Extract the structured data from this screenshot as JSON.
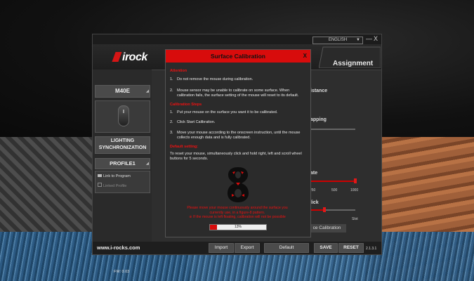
{
  "window": {
    "language": "ENGLISH",
    "minimize": "—",
    "close": "X",
    "brand": "irock",
    "tab_assignment": "Assignment"
  },
  "sidebar": {
    "model": "M40E",
    "lighting_sync_line1": "LIGHTING",
    "lighting_sync_line2": "SYNCHRONIZATION",
    "profile": "PROFILE1",
    "link_to_program": "Link to Program",
    "linked_profile": "Linked Profile",
    "firmware": "FW: 0.03"
  },
  "main_background": {
    "lift_off_distance": "istance",
    "mapping": "apping",
    "rate": "ate",
    "rate_ticks": [
      "250",
      "500",
      "1000"
    ],
    "click": "lick",
    "click_tick": "Slot",
    "surface_calibration_button": "ce Calibration"
  },
  "bottom": {
    "url": "www.i-rocks.com",
    "import": "Import",
    "export": "Export",
    "default": "Default",
    "save": "SAVE",
    "reset": "RESET",
    "version": "2.1.3.1"
  },
  "dialog": {
    "title": "Surface Calibration",
    "close": "X",
    "attention_header": "Attention",
    "attention": [
      {
        "num": "1.",
        "text": "Do not remove the mouse during calibration."
      },
      {
        "num": "2.",
        "text": "Mouse sensor may be unable to calibrate on some surface. When calibration fails, the surface setting of the mouse will reset to its default."
      }
    ],
    "steps_header": "Calibration Steps",
    "steps": [
      {
        "num": "1.",
        "text": "Put your mouse on the surface you want it to be calibrated."
      },
      {
        "num": "2.",
        "text": "Click Start Calibration."
      },
      {
        "num": "3.",
        "text": "Move your mouse according to the onscreen instruction, until the mouse collects enough data and is fully calibrated."
      }
    ],
    "default_header": "Default setting:",
    "default_text": "To reset your mouse, simultaneously click and hold right, left and scroll wheel buttons for 5 seconds.",
    "warning_line1": "Please move your mouse continuously around the surface you",
    "warning_line2": "currently use, in a figure-8 pattern.",
    "warning_line3": "※ If the mouse is left floating, calibration will not be possible",
    "progress_value": 0.13,
    "progress_label": "13%"
  },
  "colors": {
    "accent": "#d80c0c",
    "panel": "#2e2e2e"
  }
}
